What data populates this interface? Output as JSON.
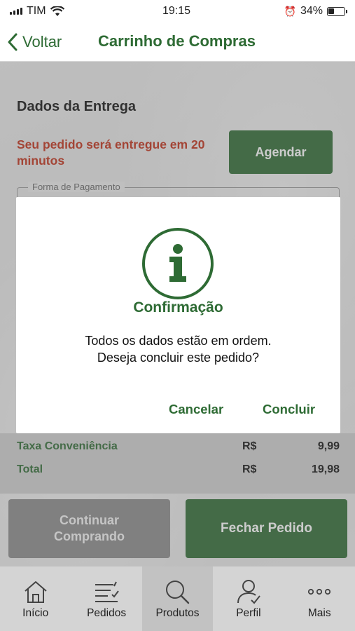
{
  "status_bar": {
    "carrier": "TIM",
    "time": "19:15",
    "battery": "34%",
    "icons": [
      "signal-icon",
      "wifi-icon",
      "alarm-icon",
      "battery-icon"
    ]
  },
  "nav": {
    "back_label": "Voltar",
    "title": "Carrinho de Compras"
  },
  "delivery": {
    "section_title": "Dados da Entrega",
    "message": "Seu pedido será entregue em 20 minutos",
    "schedule_label": "Agendar",
    "payment_legend": "Forma de Pagamento"
  },
  "modal": {
    "icon": "info-icon",
    "title": "Confirmação",
    "message_line1": "Todos os dados estão em ordem.",
    "message_line2": "Deseja concluir este pedido?",
    "cancel_label": "Cancelar",
    "confirm_label": "Concluir"
  },
  "summary": {
    "rows": [
      {
        "label": "Taxa Conveniência",
        "currency": "R$",
        "value": "9,99"
      },
      {
        "label": "Total",
        "currency": "R$",
        "value": "19,98"
      }
    ]
  },
  "actions": {
    "continue_label": "Continuar Comprando",
    "close_label": "Fechar Pedido"
  },
  "tabs": [
    {
      "label": "Início",
      "icon": "home-icon",
      "active": false
    },
    {
      "label": "Pedidos",
      "icon": "list-icon",
      "active": false
    },
    {
      "label": "Produtos",
      "icon": "search-icon",
      "active": true
    },
    {
      "label": "Perfil",
      "icon": "profile-icon",
      "active": false
    },
    {
      "label": "Mais",
      "icon": "more-icon",
      "active": false
    }
  ],
  "colors": {
    "brand_green": "#2e6b34",
    "alert_red": "#c0311a",
    "secondary_gray": "#8b8b8b"
  }
}
